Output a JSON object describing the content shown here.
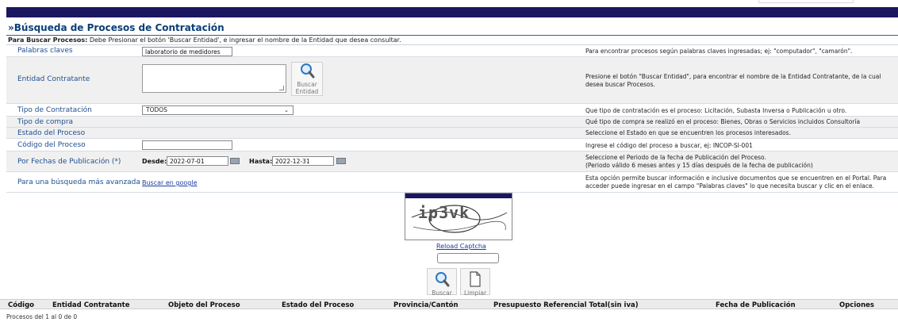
{
  "header": {
    "title": "»Búsqueda de Procesos de Contratación",
    "instruction_bold": "Para Buscar Procesos:",
    "instruction_text": " Debe Presionar el botón 'Buscar Entidad', e ingresar el nombre de la Entidad que desea consultar."
  },
  "form": {
    "palabras": {
      "label": "Palabras claves",
      "value": "laboratorio de medidores",
      "help": "Para encontrar procesos según palabras claves ingresadas; ej: \"computador\", \"camarón\"."
    },
    "entidad": {
      "label": "Entidad Contratante",
      "button_label_1": "Buscar",
      "button_label_2": "Entidad",
      "help": "Presione el botón \"Buscar Entidad\", para encontrar el nombre de la Entidad Contratante, de la cual desea buscar Procesos."
    },
    "tipo_contratacion": {
      "label": "Tipo de Contratación",
      "selected": "TODOS",
      "help": "Que tipo de contratación es el proceso: Licitación, Subasta Inversa o Publicación u otro."
    },
    "tipo_compra": {
      "label": "Tipo de compra",
      "help": "Qué tipo de compra se realizó en el proceso: Bienes, Obras o Servicios incluidos Consultoría"
    },
    "estado": {
      "label": "Estado del Proceso",
      "help": "Seleccione el Estado en que se encuentren los procesos interesados."
    },
    "codigo": {
      "label": "Código del Proceso",
      "value": "",
      "help": "Ingrese el código del proceso a buscar, ej: INCOP-SI-001"
    },
    "fechas": {
      "label": "Por Fechas de Publicación (*)",
      "desde_label": "Desde:",
      "desde_value": "2022-07-01",
      "hasta_label": "Hasta:",
      "hasta_value": "2022-12-31",
      "help_1": "Seleccione el Periodo de la fecha de Publicación del Proceso.",
      "help_2": "(Periodo válido 6 meses antes y 15 días después de la fecha de publicación)"
    },
    "avanzada": {
      "label": "Para una búsqueda más avanzada",
      "link": "Buscar en google",
      "help": "Esta opción permite buscar información e inclusive documentos que se encuentren en el Portal. Para acceder puede ingresar en el campo \"Palabras claves\" lo que necesita buscar y clic en el enlace."
    }
  },
  "captcha": {
    "text": "ip3vk",
    "reload": "Reload Captcha",
    "input_value": ""
  },
  "actions": {
    "buscar": "Buscar",
    "limpiar": "Limpiar"
  },
  "table": {
    "columns": [
      "Código",
      "Entidad Contratante",
      "Objeto del Proceso",
      "Estado del Proceso",
      "Provincia/Cantón",
      "Presupuesto Referencial Total(sin iva)",
      "Fecha de Publicación",
      "Opciones"
    ],
    "paging": "Procesos del 1 al 0 de 0"
  }
}
